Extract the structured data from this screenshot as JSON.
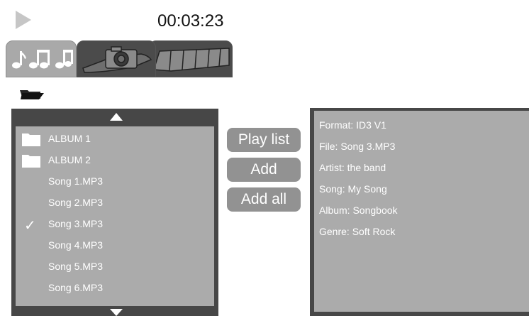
{
  "player": {
    "time": "00:03:23",
    "play_icon": "play-icon"
  },
  "tabs": [
    {
      "name": "music",
      "icon": "music-notes-icon",
      "active": true
    },
    {
      "name": "photo",
      "icon": "camera-icon",
      "active": false
    },
    {
      "name": "video",
      "icon": "film-strip-icon",
      "active": false
    }
  ],
  "browser": {
    "folder_icon": "folder-open-icon",
    "items": [
      {
        "label": "ALBUM 1",
        "type": "folder",
        "checked": false
      },
      {
        "label": "ALBUM 2",
        "type": "folder",
        "checked": false
      },
      {
        "label": "Song 1.MP3",
        "type": "file",
        "checked": false
      },
      {
        "label": "Song 2.MP3",
        "type": "file",
        "checked": false
      },
      {
        "label": "Song 3.MP3",
        "type": "file",
        "checked": true
      },
      {
        "label": "Song 4.MP3",
        "type": "file",
        "checked": false
      },
      {
        "label": "Song 5.MP3",
        "type": "file",
        "checked": false
      },
      {
        "label": "Song 6.MP3",
        "type": "file",
        "checked": false
      }
    ],
    "check_mark": "✓"
  },
  "buttons": {
    "playlist": "Play list",
    "add": "Add",
    "add_all": "Add all"
  },
  "info": {
    "lines": [
      "Format:  ID3 V1",
      "File: Song 3.MP3",
      "Artist: the band",
      "Song: My Song",
      "Album: Songbook",
      "Genre: Soft Rock"
    ]
  },
  "colors": {
    "panel_dark": "#474747",
    "panel_light": "#ababab",
    "button": "#929292",
    "active_tab": "#a9a9a9",
    "inactive_tab": "#4b4b4b",
    "text": "#ffffff"
  }
}
